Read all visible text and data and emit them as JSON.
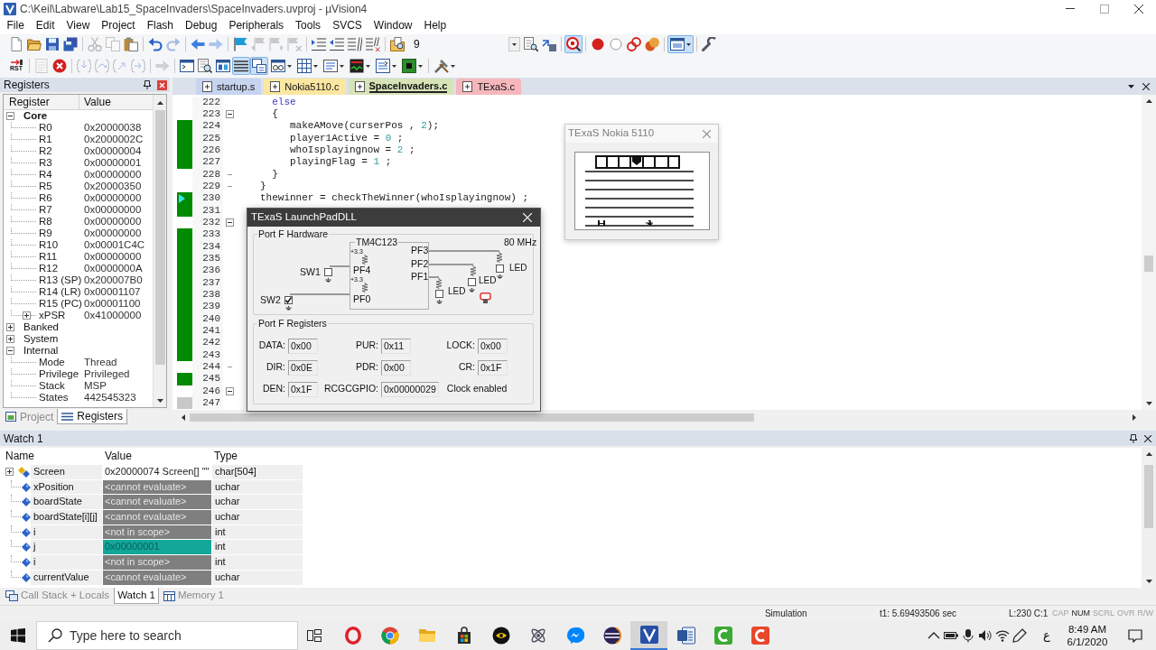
{
  "window": {
    "title": "C:\\Keil\\Labware\\Lab15_SpaceInvaders\\SpaceInvaders.uvproj - µVision4"
  },
  "menu": [
    "File",
    "Edit",
    "View",
    "Project",
    "Flash",
    "Debug",
    "Peripherals",
    "Tools",
    "SVCS",
    "Window",
    "Help"
  ],
  "toolbars": [
    {
      "find_text": "9",
      "buttons": [
        {
          "pressed": false,
          "disabled": false
        },
        {
          "pressed": false,
          "disabled": false
        },
        {
          "pressed": false,
          "disabled": false
        },
        {
          "pressed": false,
          "disabled": false
        },
        {
          "pressed": false,
          "disabled": true
        },
        {
          "pressed": false,
          "disabled": true
        },
        {
          "pressed": false,
          "disabled": false
        },
        {
          "pressed": false,
          "disabled": false
        },
        {
          "pressed": false,
          "disabled": true
        },
        {
          "pressed": false,
          "disabled": false
        },
        {
          "pressed": false,
          "disabled": true
        },
        {
          "pressed": false,
          "disabled": false
        },
        {
          "pressed": false,
          "disabled": true
        },
        {
          "pressed": false,
          "disabled": true
        },
        {
          "pressed": false,
          "disabled": true
        },
        {
          "pressed": false,
          "disabled": false
        },
        {
          "pressed": false,
          "disabled": false
        },
        {
          "pressed": false,
          "disabled": false
        },
        {
          "pressed": false,
          "disabled": false
        },
        {
          "pressed": false,
          "disabled": false
        },
        {
          "pressed": false,
          "disabled": false
        },
        {
          "pressed": false,
          "disabled": false
        },
        {
          "pressed": true,
          "disabled": false
        },
        {
          "pressed": false,
          "disabled": false
        },
        {
          "pressed": false,
          "disabled": false
        },
        {
          "pressed": false,
          "disabled": false
        },
        {
          "pressed": false,
          "disabled": false
        },
        {
          "pressed": true,
          "disabled": false
        },
        {
          "pressed": false,
          "disabled": false
        }
      ]
    },
    {
      "buttons": [
        {
          "label": "RST",
          "pressed": false,
          "disabled": false
        },
        {
          "pressed": false,
          "disabled": true
        },
        {
          "pressed": false,
          "disabled": false
        },
        {
          "pressed": false,
          "disabled": true
        },
        {
          "pressed": false,
          "disabled": true
        },
        {
          "pressed": false,
          "disabled": true
        },
        {
          "pressed": false,
          "disabled": true
        },
        {
          "pressed": false,
          "disabled": true
        },
        {
          "pressed": false,
          "disabled": false
        },
        {
          "pressed": false,
          "disabled": false
        },
        {
          "pressed": false,
          "disabled": false
        },
        {
          "pressed": true,
          "disabled": false
        },
        {
          "pressed": true,
          "disabled": false
        },
        {
          "pressed": false,
          "disabled": false
        },
        {
          "pressed": false,
          "disabled": false
        },
        {
          "pressed": false,
          "disabled": false
        },
        {
          "pressed": false,
          "disabled": false
        },
        {
          "pressed": false,
          "disabled": false
        },
        {
          "pressed": false,
          "disabled": false
        },
        {
          "pressed": false,
          "disabled": false
        }
      ]
    }
  ],
  "registers_panel": {
    "title": "Registers",
    "columns": [
      "Register",
      "Value"
    ],
    "tree": [
      {
        "label": "Core",
        "emphasized": true,
        "expanded": true,
        "children": [
          {
            "label": "R0",
            "value": "0x20000038"
          },
          {
            "label": "R1",
            "value": "0x2000002C"
          },
          {
            "label": "R2",
            "value": "0x00000004"
          },
          {
            "label": "R3",
            "value": "0x00000001"
          },
          {
            "label": "R4",
            "value": "0x00000000"
          },
          {
            "label": "R5",
            "value": "0x20000350"
          },
          {
            "label": "R6",
            "value": "0x00000000"
          },
          {
            "label": "R7",
            "value": "0x00000000"
          },
          {
            "label": "R8",
            "value": "0x00000000"
          },
          {
            "label": "R9",
            "value": "0x00000000"
          },
          {
            "label": "R10",
            "value": "0x00001C4C"
          },
          {
            "label": "R11",
            "value": "0x00000000"
          },
          {
            "label": "R12",
            "value": "0x0000000A"
          },
          {
            "label": "R13 (SP)",
            "value": "0x200007B0"
          },
          {
            "label": "R14 (LR)",
            "value": "0x00001107"
          },
          {
            "label": "R15 (PC)",
            "value": "0x00001100"
          },
          {
            "label": "xPSR",
            "value": "0x41000000",
            "expanded": false
          }
        ]
      },
      {
        "label": "Banked",
        "emphasized": false,
        "expanded": false
      },
      {
        "label": "System",
        "emphasized": false,
        "expanded": false
      },
      {
        "label": "Internal",
        "emphasized": false,
        "expanded": true,
        "children": [
          {
            "label": "Mode",
            "value": "Thread"
          },
          {
            "label": "Privilege",
            "value": "Privileged"
          },
          {
            "label": "Stack",
            "value": "MSP"
          },
          {
            "label": "States",
            "value": "442545323"
          }
        ]
      }
    ],
    "tabs": [
      {
        "label": "Project",
        "selected": false
      },
      {
        "label": "Registers",
        "selected": true
      }
    ]
  },
  "editor": {
    "tabs": [
      {
        "label": "startup.s",
        "color": "#c6d4ef",
        "selected": false
      },
      {
        "label": "Nokia5110.c",
        "color": "#fce7a1",
        "selected": false
      },
      {
        "label": "SpaceInvaders.c",
        "color": "#d6e3b6",
        "selected": true
      },
      {
        "label": "TExaS.c",
        "color": "#f5b6bc",
        "selected": false
      }
    ],
    "lines": [
      {
        "number": "222",
        "executable": false,
        "executed": false,
        "current": false,
        "fold_start": false,
        "fold_end": false,
        "tokens": [
          {
            "kind": "keyword",
            "text": "  else"
          }
        ]
      },
      {
        "number": "223",
        "executable": false,
        "executed": false,
        "current": false,
        "fold_start": true,
        "fold_end": false,
        "tokens": [
          {
            "kind": "plain",
            "text": "  {"
          }
        ]
      },
      {
        "number": "224",
        "executable": true,
        "executed": true,
        "current": false,
        "fold_start": false,
        "fold_end": false,
        "tokens": [
          {
            "kind": "plain",
            "text": "     makeAMove(curserPos , "
          },
          {
            "kind": "number",
            "text": "2"
          },
          {
            "kind": "plain",
            "text": ");"
          }
        ]
      },
      {
        "number": "225",
        "executable": true,
        "executed": true,
        "current": false,
        "fold_start": false,
        "fold_end": false,
        "tokens": [
          {
            "kind": "plain",
            "text": "     player1Active = "
          },
          {
            "kind": "number",
            "text": "0"
          },
          {
            "kind": "plain",
            "text": " ;"
          }
        ]
      },
      {
        "number": "226",
        "executable": true,
        "executed": true,
        "current": false,
        "fold_start": false,
        "fold_end": false,
        "tokens": [
          {
            "kind": "plain",
            "text": "     whoIsplayingnow = "
          },
          {
            "kind": "number",
            "text": "2"
          },
          {
            "kind": "plain",
            "text": " ;"
          }
        ]
      },
      {
        "number": "227",
        "executable": true,
        "executed": true,
        "current": false,
        "fold_start": false,
        "fold_end": false,
        "tokens": [
          {
            "kind": "plain",
            "text": "     playingFlag = "
          },
          {
            "kind": "number",
            "text": "1"
          },
          {
            "kind": "plain",
            "text": " ;"
          }
        ]
      },
      {
        "number": "228",
        "executable": false,
        "executed": false,
        "current": false,
        "fold_start": false,
        "fold_end": true,
        "tokens": [
          {
            "kind": "plain",
            "text": "  }"
          }
        ]
      },
      {
        "number": "229",
        "executable": false,
        "executed": false,
        "current": false,
        "fold_start": false,
        "fold_end": true,
        "tokens": [
          {
            "kind": "plain",
            "text": "}"
          }
        ]
      },
      {
        "number": "230",
        "executable": true,
        "executed": true,
        "current": true,
        "fold_start": false,
        "fold_end": false,
        "tokens": [
          {
            "kind": "plain",
            "text": "thewinner = checkTheWinner(whoIsplayingnow) ;"
          }
        ]
      },
      {
        "number": "231",
        "executable": true,
        "executed": true,
        "current": false,
        "fold_start": false,
        "fold_end": false
      },
      {
        "number": "232",
        "executable": false,
        "executed": false,
        "current": false,
        "fold_start": true,
        "fold_end": false
      },
      {
        "number": "233",
        "executable": true,
        "executed": true,
        "current": false,
        "fold_start": false,
        "fold_end": false
      },
      {
        "number": "234",
        "executable": true,
        "executed": true,
        "current": false,
        "fold_start": false,
        "fold_end": false
      },
      {
        "number": "235",
        "executable": true,
        "executed": true,
        "current": false,
        "fold_start": false,
        "fold_end": false
      },
      {
        "number": "236",
        "executable": true,
        "executed": true,
        "current": false,
        "fold_start": false,
        "fold_end": false
      },
      {
        "number": "237",
        "executable": true,
        "executed": true,
        "current": false,
        "fold_start": false,
        "fold_end": false
      },
      {
        "number": "238",
        "executable": true,
        "executed": true,
        "current": false,
        "fold_start": false,
        "fold_end": false
      },
      {
        "number": "239",
        "executable": true,
        "executed": true,
        "current": false,
        "fold_start": false,
        "fold_end": false
      },
      {
        "number": "240",
        "executable": true,
        "executed": true,
        "current": false,
        "fold_start": false,
        "fold_end": false
      },
      {
        "number": "241",
        "executable": true,
        "executed": true,
        "current": false,
        "fold_start": false,
        "fold_end": false
      },
      {
        "number": "242",
        "executable": true,
        "executed": true,
        "current": false,
        "fold_start": false,
        "fold_end": false
      },
      {
        "number": "243",
        "executable": true,
        "executed": true,
        "current": false,
        "fold_start": false,
        "fold_end": false
      },
      {
        "number": "244",
        "executable": false,
        "executed": false,
        "current": false,
        "fold_start": false,
        "fold_end": true
      },
      {
        "number": "245",
        "executable": true,
        "executed": true,
        "current": false,
        "fold_start": false,
        "fold_end": false
      },
      {
        "number": "246",
        "executable": false,
        "executed": false,
        "current": false,
        "fold_start": true,
        "fold_end": false
      },
      {
        "number": "247",
        "executable": true,
        "executed": false,
        "current": false,
        "fold_start": false,
        "fold_end": false
      }
    ]
  },
  "launchpad_dialog": {
    "title": "TExaS LaunchPadDLL",
    "hardware": {
      "title": "Port F Hardware",
      "chip": "TM4C123",
      "clock": "80 MHz",
      "supply_labels": [
        "+3.3",
        "+3.3"
      ],
      "switches": [
        {
          "label": "SW1",
          "pin": "PF4",
          "checked": false
        },
        {
          "label": "SW2",
          "pin": "PF0",
          "checked": true
        }
      ],
      "outputs": [
        {
          "pin": "PF3",
          "led": "LED",
          "on": false
        },
        {
          "pin": "PF2",
          "led": "LED",
          "on": false
        },
        {
          "pin": "PF1",
          "led": "LED",
          "on": false
        }
      ]
    },
    "registers": {
      "title": "Port F Registers",
      "rows": [
        [
          {
            "label": "DATA:",
            "value": "0x00"
          },
          {
            "label": "PUR:",
            "value": "0x11"
          },
          {
            "label": "LOCK:",
            "value": "0x00"
          }
        ],
        [
          {
            "label": "DIR:",
            "value": "0x0E"
          },
          {
            "label": "PDR:",
            "value": "0x00"
          },
          {
            "label": "CR:",
            "value": "0x1F"
          }
        ],
        [
          {
            "label": "DEN:",
            "value": "0x1F"
          },
          {
            "label": "RCGCGPIO:",
            "value": "0x00000029"
          }
        ]
      ],
      "clock_status": "Clock enabled"
    }
  },
  "nokia_dialog": {
    "title": "TExaS Nokia 5110"
  },
  "watch_panel": {
    "title": "Watch 1",
    "columns": [
      "Name",
      "Value",
      "Type"
    ],
    "rows": [
      {
        "name": "Screen",
        "kind": "array",
        "expanded": false,
        "value": "0x20000074 Screen[] \"\"",
        "unavailable": false,
        "changed": false,
        "type": "char[504]"
      },
      {
        "name": "xPosition",
        "kind": "variable",
        "value": "<cannot evaluate>",
        "unavailable": true,
        "changed": false,
        "type": "uchar"
      },
      {
        "name": "boardState",
        "kind": "variable",
        "value": "<cannot evaluate>",
        "unavailable": true,
        "changed": false,
        "type": "uchar"
      },
      {
        "name": "boardState[i][j]",
        "kind": "variable",
        "value": "<cannot evaluate>",
        "unavailable": true,
        "changed": false,
        "type": "uchar"
      },
      {
        "name": "i",
        "kind": "variable",
        "value": "<not in scope>",
        "unavailable": true,
        "changed": false,
        "type": "int"
      },
      {
        "name": "j",
        "kind": "variable",
        "value": "0x00000001",
        "unavailable": false,
        "changed": true,
        "type": "int"
      },
      {
        "name": "i",
        "kind": "variable",
        "value": "<not in scope>",
        "unavailable": true,
        "changed": false,
        "type": "int"
      },
      {
        "name": "currentValue",
        "kind": "variable",
        "value": "<cannot evaluate>",
        "unavailable": true,
        "changed": false,
        "type": "uchar"
      }
    ],
    "tabs": [
      {
        "label": "Call Stack + Locals",
        "selected": false
      },
      {
        "label": "Watch 1",
        "selected": true
      },
      {
        "label": "Memory 1",
        "selected": false
      }
    ]
  },
  "status_bar": {
    "mode": "Simulation",
    "time": "t1: 5.69493506 sec",
    "cursor": "L:230 C:1",
    "indicators": [
      {
        "label": "CAP",
        "on": false
      },
      {
        "label": "NUM",
        "on": true
      },
      {
        "label": "SCRL",
        "on": false
      },
      {
        "label": "OVR",
        "on": false
      },
      {
        "label": "R/W",
        "on": false
      }
    ]
  },
  "taskbar": {
    "search": {
      "placeholder": "Type here to search"
    },
    "apps": [
      {
        "active": false
      },
      {
        "active": false
      },
      {
        "active": false
      },
      {
        "active": false
      },
      {
        "active": false
      },
      {
        "active": false
      },
      {
        "active": false
      },
      {
        "active": false
      },
      {
        "active": true
      },
      {
        "active": false
      },
      {
        "active": false
      },
      {
        "active": false
      }
    ],
    "language": "ع",
    "time": "8:49 AM",
    "date": "6/1/2020"
  }
}
